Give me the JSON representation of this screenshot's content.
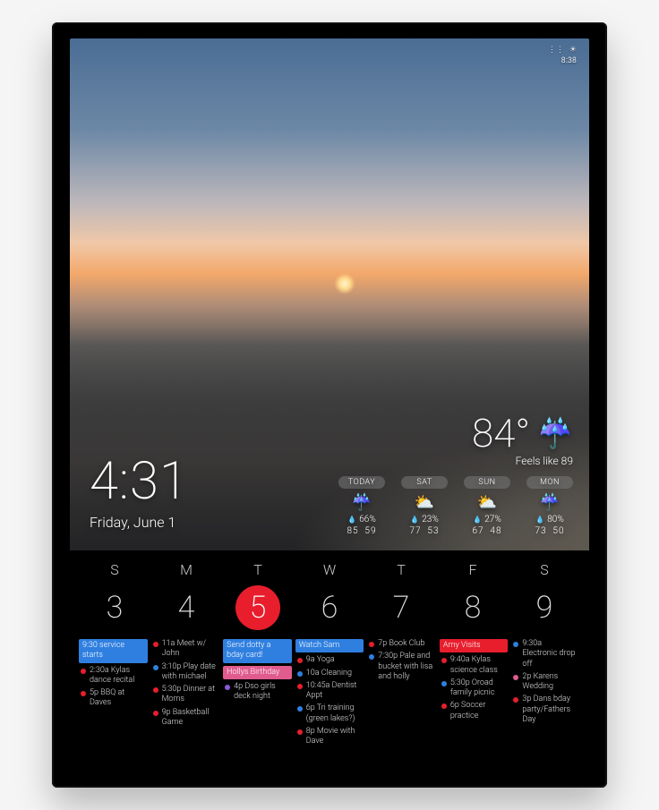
{
  "status": {
    "signal": "⋮⋮",
    "time_small": "8:38",
    "sun": "☀"
  },
  "clock": {
    "time": "4:31",
    "date": "Friday, June 1"
  },
  "weather": {
    "temp": "84°",
    "icon": "☔",
    "feels": "Feels like 89",
    "forecast": [
      {
        "label": "TODAY",
        "icon": "☔",
        "precip": "66%",
        "hi": "85",
        "lo": "59"
      },
      {
        "label": "SAT",
        "icon": "⛅",
        "precip": "23%",
        "hi": "77",
        "lo": "53"
      },
      {
        "label": "SUN",
        "icon": "⛅",
        "precip": "27%",
        "hi": "67",
        "lo": "48"
      },
      {
        "label": "MON",
        "icon": "☔",
        "precip": "80%",
        "hi": "73",
        "lo": "50"
      }
    ]
  },
  "calendar": {
    "dow": [
      "S",
      "M",
      "T",
      "W",
      "T",
      "F",
      "S"
    ],
    "dates": [
      "3",
      "4",
      "5",
      "6",
      "7",
      "8",
      "9"
    ],
    "today_index": 2,
    "days": [
      [
        {
          "type": "bar",
          "color": "c-blue",
          "text": "9:30 service starts"
        },
        {
          "type": "dot",
          "color": "d-red",
          "text": "2:30a Kylas dance recital"
        },
        {
          "type": "dot",
          "color": "d-red",
          "text": "5p BBQ at Daves"
        }
      ],
      [
        {
          "type": "dot",
          "color": "d-red",
          "text": "11a Meet w/ John"
        },
        {
          "type": "dot",
          "color": "d-blue",
          "text": "3:10p Play date with michael"
        },
        {
          "type": "dot",
          "color": "d-red",
          "text": "5:30p Dinner at Moms"
        },
        {
          "type": "dot",
          "color": "d-red",
          "text": "9p Basketball Game"
        }
      ],
      [
        {
          "type": "bar",
          "color": "c-blue",
          "text": "Send dotty a bday card!"
        },
        {
          "type": "bar",
          "color": "c-pink",
          "text": "Hollys Birthday"
        },
        {
          "type": "dot",
          "color": "d-purple",
          "text": "4p Dso girls deck night"
        }
      ],
      [
        {
          "type": "bar",
          "color": "c-blue",
          "text": "Watch Sam"
        },
        {
          "type": "dot",
          "color": "d-red",
          "text": "9a Yoga"
        },
        {
          "type": "dot",
          "color": "d-blue",
          "text": "10a Cleaning"
        },
        {
          "type": "dot",
          "color": "d-red",
          "text": "10:45a Dentist Appt"
        },
        {
          "type": "dot",
          "color": "d-blue",
          "text": "6p Tri training (green lakes?)"
        },
        {
          "type": "dot",
          "color": "d-red",
          "text": "8p Movie with Dave"
        }
      ],
      [
        {
          "type": "dot",
          "color": "d-red",
          "text": "7p Book Club"
        },
        {
          "type": "dot",
          "color": "d-blue",
          "text": "7:30p Pale and bucket with lisa and holly"
        }
      ],
      [
        {
          "type": "bar",
          "color": "c-red",
          "text": "Amy Visits"
        },
        {
          "type": "dot",
          "color": "d-red",
          "text": "9:40a Kylas science class"
        },
        {
          "type": "dot",
          "color": "d-blue",
          "text": "5:30p Oroad family picnic"
        },
        {
          "type": "dot",
          "color": "d-red",
          "text": "6p Soccer practice"
        }
      ],
      [
        {
          "type": "dot",
          "color": "d-blue",
          "text": "9:30a Electronic drop off"
        },
        {
          "type": "dot",
          "color": "d-pink",
          "text": "2p Karens Wedding"
        },
        {
          "type": "dot",
          "color": "d-red",
          "text": "3p Dans bday party/Fathers Day"
        }
      ]
    ]
  }
}
